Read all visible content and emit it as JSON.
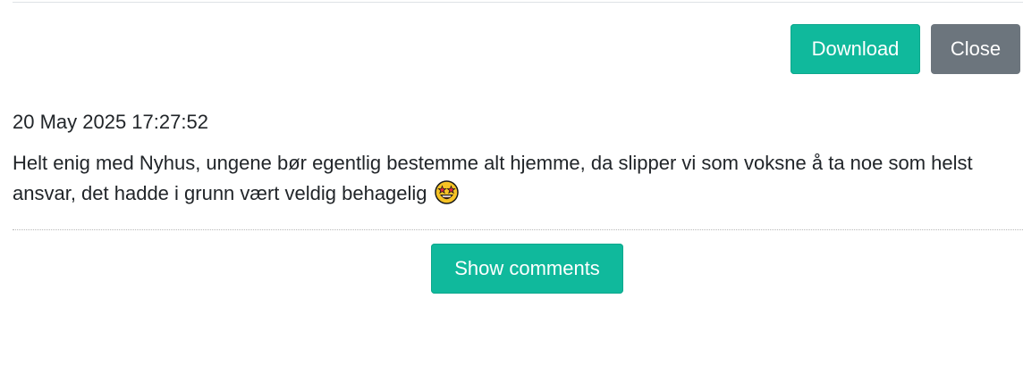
{
  "toolbar": {
    "download_label": "Download",
    "close_label": "Close"
  },
  "post": {
    "timestamp": "20 May 2025 17:27:52",
    "text": "Helt enig med Nyhus, ungene bør egentlig bestemme alt hjemme, da slipper vi som voksne å ta noe som helst ansvar, det hadde i grunn vært veldig behagelig",
    "emoji_icon": "star-struck-emoji-icon"
  },
  "comments": {
    "show_label": "Show comments"
  },
  "colors": {
    "primary": "#10b99c",
    "secondary": "#6c757d",
    "text": "#212529"
  }
}
